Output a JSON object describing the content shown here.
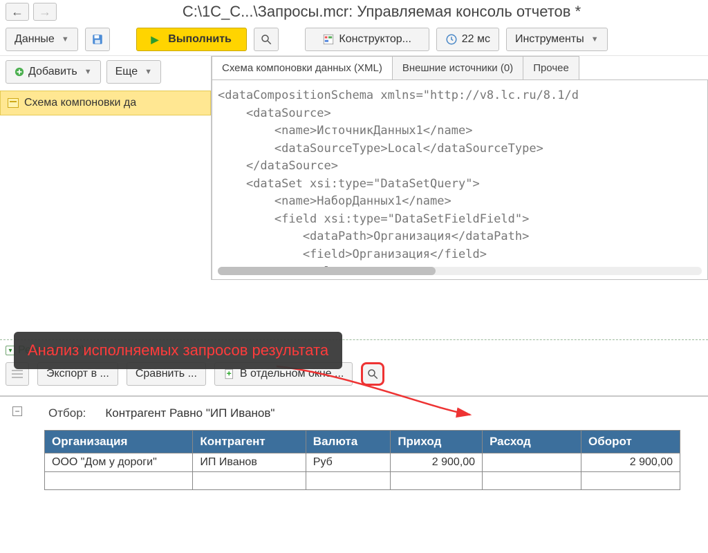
{
  "title": "C:\\1C_C...\\Запросы.mcr: Управляемая консоль отчетов *",
  "toolbar": {
    "data_label": "Данные",
    "execute_label": "Выполнить",
    "constructor_label": "Конструктор...",
    "time_label": "22 мс",
    "tools_label": "Инструменты"
  },
  "left": {
    "add_label": "Добавить",
    "more_label": "Еще",
    "tree_item": "Схема компоновки да"
  },
  "tabs": {
    "t0": "Схема компоновки данных (XML)",
    "t1": "Внешние источники (0)",
    "t2": "Прочее"
  },
  "xml_text": "<dataCompositionSchema xmlns=\"http://v8.lc.ru/8.1/d\n    <dataSource>\n        <name>ИсточникДанных1</name>\n        <dataSourceType>Local</dataSourceType>\n    </dataSource>\n    <dataSet xsi:type=\"DataSetQuery\">\n        <name>НаборДанных1</name>\n        <field xsi:type=\"DataSetFieldField\">\n            <dataPath>Организация</dataPath>\n            <field>Организация</field>\n            <role>",
  "annotation": "Анализ исполняемых запросов результата",
  "result": {
    "header": "Результат (?)",
    "export_label": "Экспорт в ...",
    "compare_label": "Сравнить ...",
    "window_label": "В отдельном окне ...",
    "filter_label": "Отбор:",
    "filter_value": "Контрагент Равно \"ИП Иванов\"",
    "columns": {
      "c0": "Организация",
      "c1": "Контрагент",
      "c2": "Валюта",
      "c3": "Приход",
      "c4": "Расход",
      "c5": "Оборот"
    },
    "rows": [
      {
        "c0": "ООО \"Дом у дороги\"",
        "c1": "ИП Иванов",
        "c2": "Руб",
        "c3": "2 900,00",
        "c4": "",
        "c5": "2 900,00"
      }
    ]
  }
}
